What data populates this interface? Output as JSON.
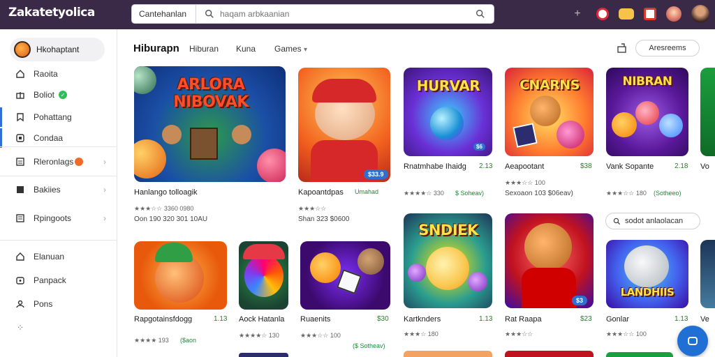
{
  "app": {
    "logo_text": "Zakatetyolica"
  },
  "search": {
    "scope": "Cantehanlan",
    "placeholder": "haqam arbkaanian"
  },
  "sidebar": {
    "profile_name": "Hkohaptant",
    "items": [
      {
        "label": "Raoita"
      },
      {
        "label": "Boliot"
      },
      {
        "label": "Pohattang"
      },
      {
        "label": "Condaa"
      },
      {
        "label": "Rleronlags"
      },
      {
        "label": "Bakiies"
      },
      {
        "label": "Rpingoots"
      },
      {
        "label": "Elanuan"
      },
      {
        "label": "Panpack"
      },
      {
        "label": "Pons"
      }
    ]
  },
  "main": {
    "title": "Hiburapn",
    "tabs": [
      "Hiburan",
      "Kuna",
      "Games"
    ],
    "filter_label": "Aresreems",
    "search_chip": "sodot anlaolacan"
  },
  "cards": [
    {
      "thumb_title": "ARLORA NIBOVAK",
      "title": "Hanlango tolloagik",
      "meta": "★★★☆☆ 3360 0980",
      "line": "Oon 190   320 301   10AU"
    },
    {
      "thumb_title": "",
      "price_badge": "$33.9",
      "title": "Kapoantdpas",
      "tag": "Umahad",
      "meta": "★★★☆☆",
      "line": "Shan 323   $0600"
    },
    {
      "thumb_title": "HURVAR",
      "title": "Rnatmhabe Ihaidg",
      "price": "2.13",
      "meta": "★★★★☆ 330",
      "tag": "$ Soheav)"
    },
    {
      "thumb_title": "CNARNS",
      "title": "Aeapootant",
      "price": "$38",
      "meta": "★★★☆☆ 100",
      "line": "Sexoaon 103   $06eav)"
    },
    {
      "thumb_title": "NIBRAN",
      "title": "Vank Sopante",
      "price": "2.18",
      "meta": "★★★☆☆ 180",
      "tag": "(Sotheeo)"
    },
    {
      "thumb_title": "",
      "title": "Vo",
      "price": "",
      "meta": "",
      "line": ""
    },
    {
      "thumb_title": "",
      "title": "Rapgotainsfdogg",
      "price": "1.13",
      "meta": "★★★★ 193",
      "tag": "($aon"
    },
    {
      "thumb_title": "",
      "title": "Aock Hatanla",
      "price": "",
      "meta": "★★★★☆ 130",
      "line": ""
    },
    {
      "thumb_title": "",
      "title": "Ruaenits",
      "price": "$30",
      "meta": "★★★☆☆ 100",
      "tag": "($ Sotheav)"
    },
    {
      "thumb_title": "SNDIEK",
      "title": "Kartknders",
      "price": "1.13",
      "meta": "★★★☆ 180",
      "line": ""
    },
    {
      "thumb_title": "",
      "price_badge": "$3",
      "title": "Rat Raapa",
      "price": "$23",
      "meta": "★★★☆☆",
      "line": ""
    },
    {
      "thumb_title": "LANDHIIS",
      "title": "Gonlar",
      "price": "1.13",
      "meta": "★★★☆☆ 100",
      "tag": ""
    },
    {
      "thumb_title": "",
      "title": "Ve",
      "price": "",
      "meta": "",
      "line": ""
    }
  ],
  "colors": {
    "topbar": "#3a2a48",
    "accent": "#2f6fd6",
    "price_green": "#2f7a2f",
    "star": "#f3a521"
  }
}
